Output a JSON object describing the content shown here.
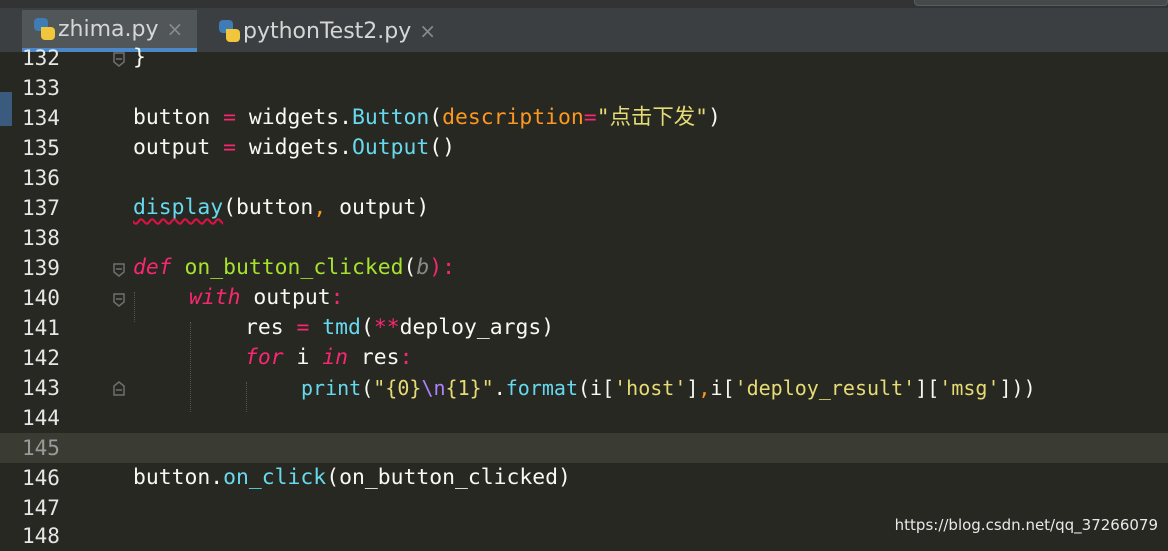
{
  "tabs": [
    {
      "label": "zhima.py",
      "close": "×",
      "icon": "python-file-icon"
    },
    {
      "label": "pythonTest2.py",
      "close": "×",
      "icon": "python-file-icon"
    }
  ],
  "line_numbers": [
    "132",
    "133",
    "134",
    "135",
    "136",
    "137",
    "138",
    "139",
    "140",
    "141",
    "142",
    "143",
    "144",
    "145",
    "146",
    "147",
    "148"
  ],
  "code": {
    "l132": "}",
    "l134": {
      "a": "button ",
      "b": "=",
      "c": " widgets.",
      "d": "Button",
      "e": "(",
      "f": "description",
      "g": "=",
      "h": "\"点击下发\"",
      "i": ")"
    },
    "l135": {
      "a": "output ",
      "b": "=",
      "c": " widgets.",
      "d": "Output",
      "e": "()"
    },
    "l137": {
      "a": "display",
      "b": "(button",
      "c": ",",
      "d": " output)"
    },
    "l139": {
      "a": "def",
      "b": " ",
      "c": "on_button_clicked",
      "d": "(",
      "e": "b",
      "f": "):"
    },
    "l140": {
      "a": "with",
      "b": " output",
      "c": ":"
    },
    "l141": {
      "a": "res ",
      "b": "=",
      "c": " ",
      "d": "tmd",
      "e": "(",
      "f": "**",
      "g": "deploy_args)"
    },
    "l142": {
      "a": "for",
      "b": " i ",
      "c": "in",
      "d": " res",
      "e": ":"
    },
    "l143": {
      "a": "print",
      "b": "(",
      "c": "\"{0}",
      "d": "\\n",
      "e": "{1}\"",
      "f": ".",
      "g": "format",
      "h": "(i[",
      "i": "'host'",
      "j": "]",
      "k": ",",
      "l": "i[",
      "m": "'deploy_result'",
      "n": "][",
      "o": "'msg'",
      "p": "]))"
    },
    "l146": {
      "a": "button.",
      "b": "on_click",
      "c": "(on_button_clicked)"
    }
  },
  "watermark": "https://blog.csdn.net/qq_37266079",
  "colors": {
    "background": "#272822",
    "keyword": "#f92672",
    "builtin": "#66d9ef",
    "function_def": "#a6e22e",
    "string": "#e6db74",
    "tab_accent": "#4a88c7"
  }
}
